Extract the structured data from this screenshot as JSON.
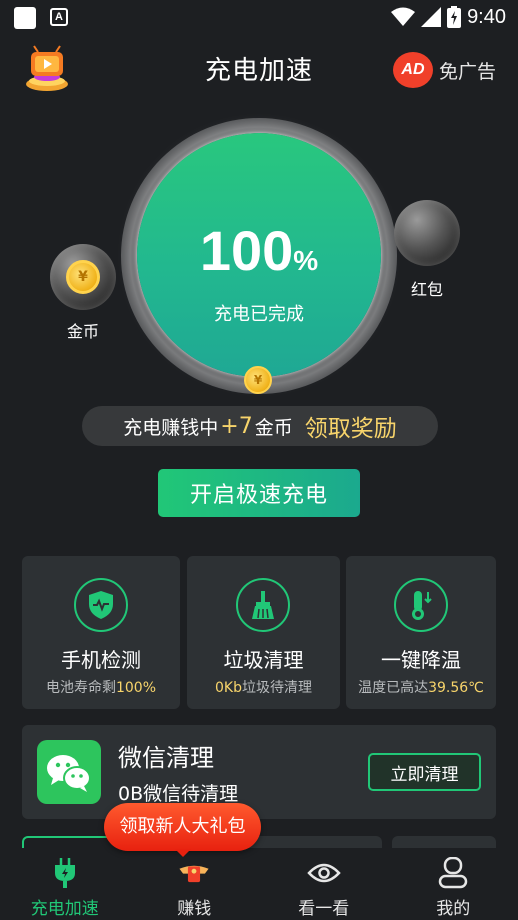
{
  "status_bar": {
    "time": "9:40",
    "indicator_a": "A"
  },
  "header": {
    "title": "充电加速",
    "no_ads_badge": "AD",
    "no_ads_label": "免广告"
  },
  "charge": {
    "percent": "100",
    "percent_sign": "%",
    "status": "充电已完成",
    "level": 1.0
  },
  "bubbles": {
    "coin_label": "金币",
    "red_packet_label": "红包",
    "coin_symbol": "¥"
  },
  "earn": {
    "prefix": "充电赚钱中",
    "amount": "+7",
    "unit": " 金币",
    "claim": "领取奖励"
  },
  "fast_charge_button": "开启极速充电",
  "features": [
    {
      "title": "手机检测",
      "sub_prefix": "电池寿命剩",
      "sub_value": "100%",
      "icon": "shield-pulse-icon"
    },
    {
      "title": "垃圾清理",
      "sub_value": "0Kb",
      "sub_suffix": "垃圾待清理",
      "icon": "broom-icon"
    },
    {
      "title": "一键降温",
      "sub_prefix": "温度已高达",
      "sub_value": "39.56℃",
      "icon": "thermometer-icon"
    }
  ],
  "wechat": {
    "title": "微信清理",
    "sub": "0B微信待清理",
    "button": "立即清理"
  },
  "gift_bubble": "领取新人大礼包",
  "nav": [
    {
      "label": "充电加速",
      "icon": "plug-icon",
      "active": true
    },
    {
      "label": "赚钱",
      "icon": "red-packet-icon",
      "active": false
    },
    {
      "label": "看一看",
      "icon": "eye-icon",
      "active": false
    },
    {
      "label": "我的",
      "icon": "user-icon",
      "active": false
    }
  ],
  "colors": {
    "accent": "#21c777",
    "gold": "#f7d46b",
    "background": "#1d1f22",
    "card": "#2d3134",
    "danger": "#f0402a"
  }
}
